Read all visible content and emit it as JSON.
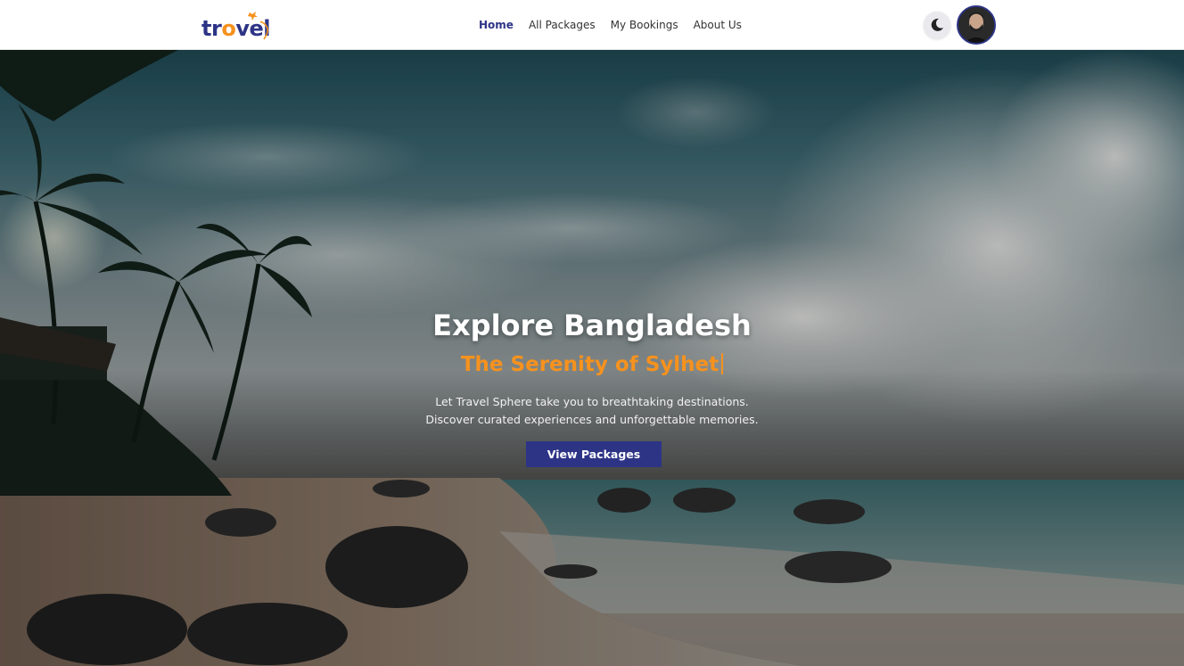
{
  "brand": {
    "logo_text_prefix": "tr",
    "logo_text_o": "o",
    "logo_text_suffix": "vel",
    "accent": "#f6921e",
    "primary": "#2d3486"
  },
  "nav": {
    "links": [
      {
        "label": "Home",
        "active": true
      },
      {
        "label": "All Packages",
        "active": false
      },
      {
        "label": "My Bookings",
        "active": false
      },
      {
        "label": "About Us",
        "active": false
      }
    ],
    "theme_icon": "moon-icon",
    "avatar_icon": "user-avatar"
  },
  "hero": {
    "title": "Explore Bangladesh",
    "subtitle": "The Serenity of Sylhet",
    "desc_line1": "Let Travel Sphere take you to breathtaking destinations.",
    "desc_line2": "Discover curated experiences and unforgettable memories.",
    "cta_label": "View Packages"
  }
}
